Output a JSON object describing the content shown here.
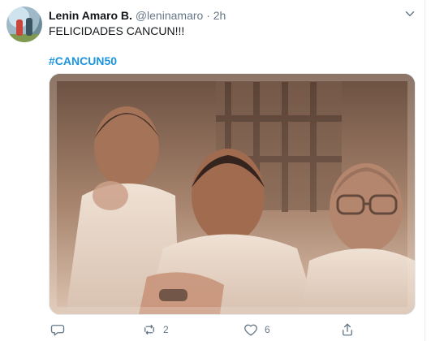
{
  "tweet": {
    "author_name": "Lenin Amaro B.",
    "handle": "@leninamaro",
    "separator": "·",
    "time": "2h",
    "text": "FELICIDADES  CANCUN!!!",
    "hashtag": "#CANCUN50",
    "retweet_count": "2",
    "like_count": "6"
  },
  "icons": {
    "avatar": "avatar",
    "menu": "chevron-down-icon",
    "reply": "reply-icon",
    "retweet": "retweet-icon",
    "like": "heart-icon",
    "share": "share-icon"
  },
  "colors": {
    "link": "#1b95e0",
    "muted": "#657786",
    "text": "#14171a"
  }
}
